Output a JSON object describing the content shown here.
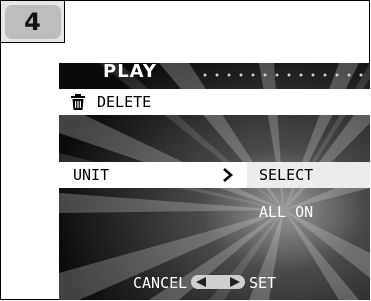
{
  "step": {
    "number": "4"
  },
  "screen": {
    "title": "PLAY",
    "menu": {
      "delete": {
        "icon": "trash-icon",
        "label": "DELETE"
      },
      "unit": {
        "label": "UNIT",
        "icon": "chevron-right-icon"
      }
    },
    "options": [
      {
        "label": "SELECT",
        "selected": true
      },
      {
        "label": "ALL ON",
        "selected": false
      }
    ],
    "footer": {
      "cancel_label": "CANCEL",
      "nav_icon": "left-right-arrows-icon",
      "set_label": "SET"
    }
  },
  "colors": {
    "lcd_background": "#0a0a0a",
    "highlight_row": "#ffffff",
    "selected_option": "#ececec",
    "step_badge": "#bdbdbd"
  }
}
